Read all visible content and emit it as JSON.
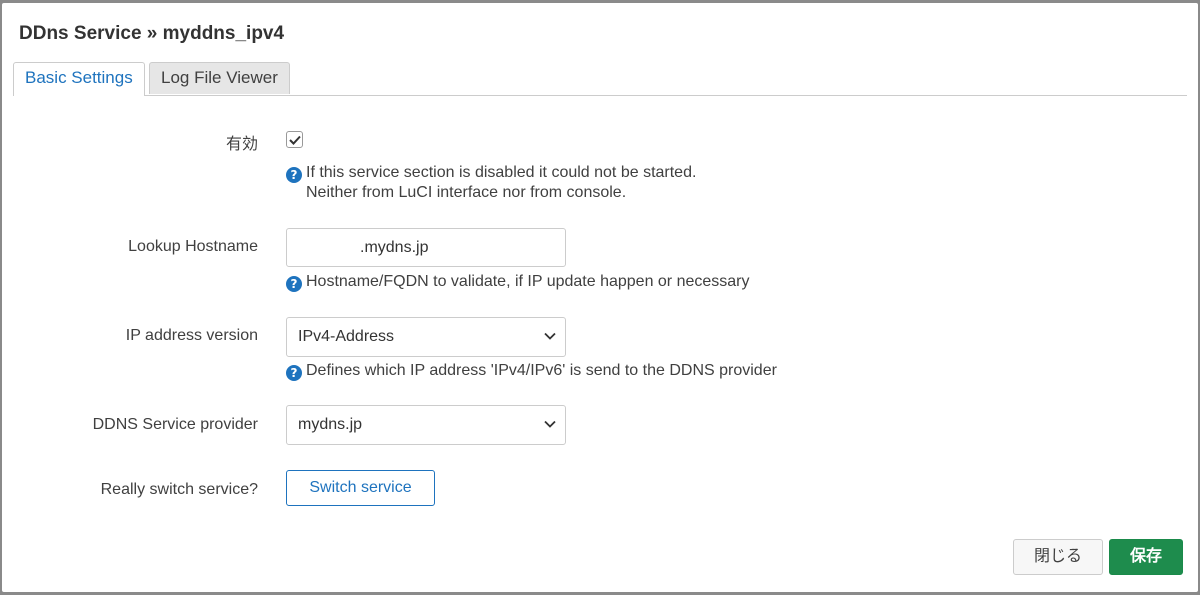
{
  "dialog": {
    "title": "DDns Service » myddns_ipv4"
  },
  "tabs": [
    {
      "label": "Basic Settings",
      "active": true
    },
    {
      "label": "Log File Viewer",
      "active": false
    }
  ],
  "fields": {
    "enabled": {
      "label": "有効",
      "checked": true,
      "help_line1": "If this service section is disabled it could not be started.",
      "help_line2": "Neither from LuCI interface nor from console."
    },
    "lookup_hostname": {
      "label": "Lookup Hostname",
      "value": ".mydns.jp",
      "help": "Hostname/FQDN to validate, if IP update happen or necessary"
    },
    "ip_version": {
      "label": "IP address version",
      "value": "IPv4-Address",
      "help": "Defines which IP address 'IPv4/IPv6' is send to the DDNS provider"
    },
    "service_provider": {
      "label": "DDNS Service provider",
      "value": "mydns.jp"
    },
    "switch_service": {
      "label": "Really switch service?",
      "button_label": "Switch service"
    }
  },
  "footer": {
    "close_label": "閉じる",
    "save_label": "保存"
  },
  "colors": {
    "accent": "#1e73be",
    "save": "#1e8c4d"
  }
}
